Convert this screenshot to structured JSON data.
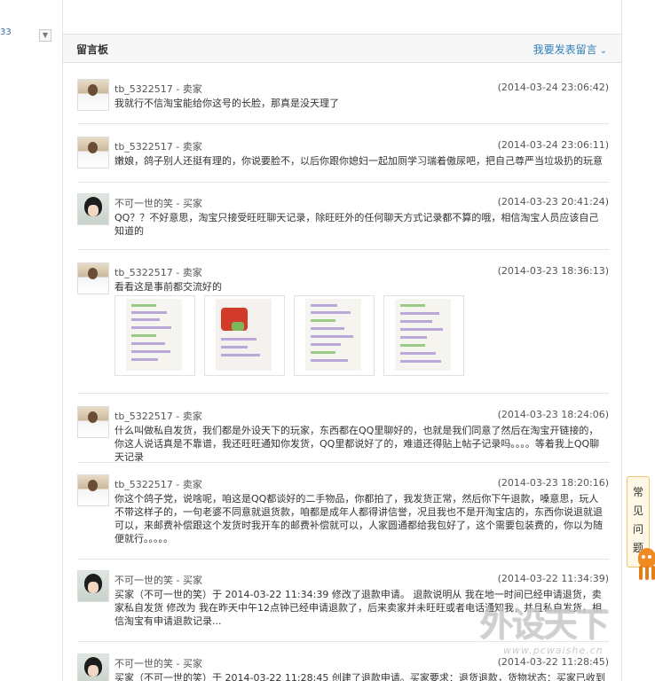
{
  "sidebar": {
    "partial_number": "33",
    "toggle_icon": "chevron-down-icon"
  },
  "panel": {
    "title": "留言板",
    "action_label": "我要发表留言",
    "action_icon": "chevron-down-icon"
  },
  "messages": [
    {
      "author": "tb_5322517 - 卖家",
      "time": "(2014-03-24 23:06:42)",
      "content": "我就行不信淘宝能给你这号的长脸，那真是没天理了",
      "avatar": "seller-avatar"
    },
    {
      "author": "tb_5322517 - 卖家",
      "time": "(2014-03-24 23:06:11)",
      "content": "嫩娘，鸽子别人还挺有理的，你说要脸不，以后你跟你媳妇一起加厕学习瑞着傲尿吧，把自己尊严当垃圾扔的玩意",
      "avatar": "seller-avatar"
    },
    {
      "author": "不可一世的笑 - 买家",
      "time": "(2014-03-23 20:41:24)",
      "content": "QQ？？不好意思，淘宝只接受旺旺聊天记录，除旺旺外的任何聊天方式记录都不算的哦，相信淘宝人员应该自己知道的",
      "avatar": "buyer-avatar"
    },
    {
      "author": "tb_5322517 - 卖家",
      "time": "(2014-03-23 18:36:13)",
      "content": "看看这是事前都交流好的",
      "avatar": "seller-avatar",
      "attachments": [
        "chat-screenshot-thumbnail",
        "red-photo-thumbnail",
        "chat-screenshot-thumbnail",
        "chat-screenshot-thumbnail"
      ]
    },
    {
      "author": "tb_5322517 - 卖家",
      "time": "(2014-03-23 18:24:06)",
      "content": "什么叫做私自发货，我们都是外设天下的玩家，东西都在QQ里聊好的，也就是我们同意了然后在淘宝开链接的，你这人说话真是不靠谱，我还旺旺通知你发货，QQ里都说好了的，难道还得贴上帖子记录吗。。。。等着我上QQ聊天记录",
      "avatar": "seller-avatar"
    },
    {
      "author": "tb_5322517 - 卖家",
      "time": "(2014-03-23 18:20:16)",
      "content": "你这个鸽子党，说啥呢，咱这是QQ都谈好的二手物品，你都拍了，我发货正常，然后你下午退款，嗓意思，玩人不带这样子的，一句老婆不同意就退货款，咱都是成年人都得讲信誉，况且我也不是开淘宝店的，东西你说退就退可以，来邮费补偿跟这个发货时我开车的邮费补偿就可以，人家圆通都给我包好了，这个需要包装费的，你以为随便就行。。。。。",
      "avatar": "seller-avatar"
    },
    {
      "author": "不可一世的笑 - 买家",
      "time": "(2014-03-22 11:34:39)",
      "content": "买家（不可一世的笑）于 2014-03-22 11:34:39 修改了退款申请。 退款说明从 我在地一时间已经申请退货，卖家私自发货 修改为 我在昨天中午12点钟已经申请退款了，后来卖家并未旺旺或者电话通知我，并且私自发货，相信淘宝有申请退款记录...",
      "avatar": "buyer-avatar"
    },
    {
      "author": "不可一世的笑 - 买家",
      "time": "(2014-03-22 11:28:45)",
      "content": "买家（不可一世的笑）于 2014-03-22 11:28:45 创建了退款申请。买家要求：退货退款，货物状态：买家已收到货，",
      "avatar": "buyer-avatar"
    }
  ],
  "help_tab": {
    "chars": [
      "常",
      "见",
      "问",
      "题"
    ]
  },
  "watermark": {
    "logo_text": "外设天下",
    "url": "www.pcwaishe.cn"
  }
}
